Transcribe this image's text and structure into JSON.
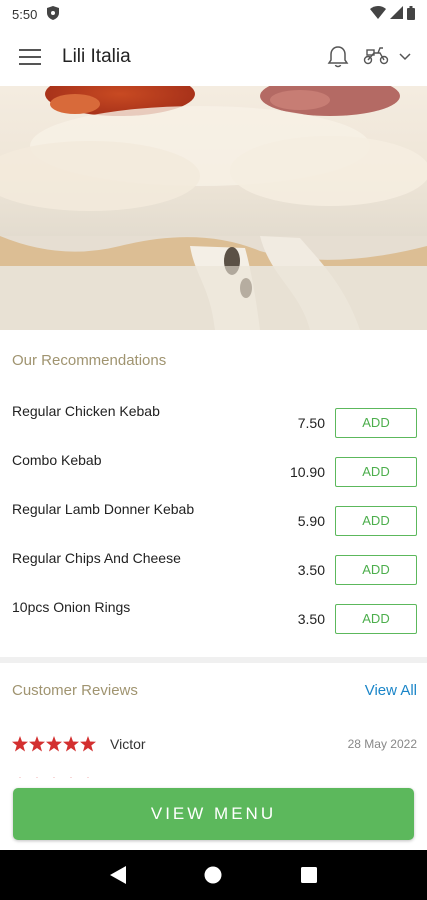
{
  "status_bar": {
    "time": "5:50",
    "icons": [
      "shield-icon",
      "wifi-icon",
      "signal-icon",
      "battery-icon"
    ]
  },
  "app_bar": {
    "title": "Lili Italia",
    "icons": [
      "menu-icon",
      "bell-icon",
      "scooter-icon",
      "chevron-down-icon"
    ]
  },
  "recommendations": {
    "title": "Our Recommendations",
    "items": [
      {
        "name": "Regular Chicken Kebab",
        "price": "7.50",
        "button": "ADD"
      },
      {
        "name": "Combo Kebab",
        "price": "10.90",
        "button": "ADD"
      },
      {
        "name": "Regular Lamb Donner Kebab",
        "price": "5.90",
        "button": "ADD"
      },
      {
        "name": "Regular Chips And Cheese",
        "price": "3.50",
        "button": "ADD"
      },
      {
        "name": "10pcs Onion Rings",
        "price": "3.50",
        "button": "ADD"
      }
    ]
  },
  "reviews": {
    "title": "Customer Reviews",
    "view_all": "View All",
    "items": [
      {
        "reviewer": "Victor",
        "date": "28 May 2022",
        "stars": 5
      }
    ]
  },
  "view_menu": "VIEW MENU",
  "colors": {
    "accent_green": "#5cb85c",
    "section_title": "#a09470",
    "link_blue": "#1a85c8",
    "star_red": "#d32f2f"
  }
}
